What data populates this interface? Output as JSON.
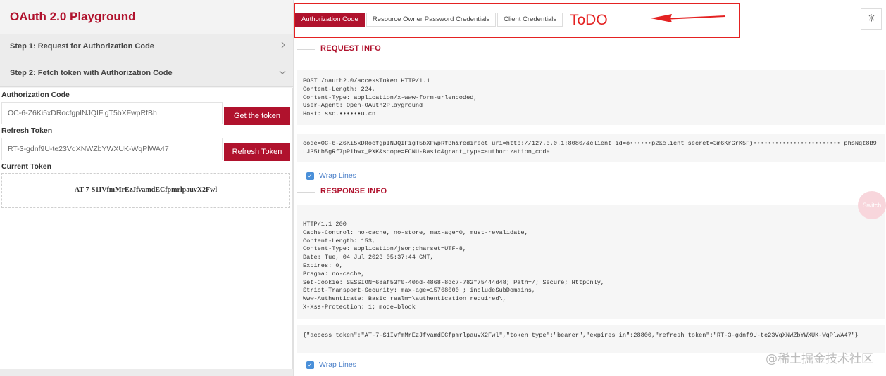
{
  "app": {
    "title": "OAuth 2.0 Playground"
  },
  "steps": [
    {
      "label": "Step 1: Request for Authorization Code",
      "chevron": "chevron-right-icon"
    },
    {
      "label": "Step 2: Fetch token with Authorization Code",
      "chevron": "chevron-down-icon"
    }
  ],
  "form": {
    "auth_code_label": "Authorization Code",
    "auth_code_value": "OC-6-Z6Ki5xDRocfgpINJQIFigT5bXFwpRfBh",
    "get_token_label": "Get the token",
    "refresh_token_label": "Refresh Token",
    "refresh_token_value": "RT-3-gdnf9U-te23VqXNWZbYWXUK-WqPlWA47",
    "refresh_button_label": "Refresh Token",
    "current_token_label": "Current Token",
    "current_token_value": "AT-7-S1IVfmMrEzJfvamdECfpmrlpauvX2Fwl"
  },
  "tabs": [
    {
      "label": "Authorization Code",
      "active": true
    },
    {
      "label": "Resource Owner Password Credentials",
      "active": false
    },
    {
      "label": "Client Credentials",
      "active": false
    }
  ],
  "annotation": {
    "text": "ToDO",
    "color": "#e42222"
  },
  "settings_icon": "gear-icon",
  "request": {
    "heading": "REQUEST INFO",
    "headers": "POST /oauth2.0/accessToken HTTP/1.1\nContent-Length: 224,\nContent-Type: application/x-www-form-urlencoded,\nUser-Agent: Open-OAuth2Playground\nHost: sso.••••••u.cn",
    "body": "code=OC-6-Z6Ki5xDRocfgpINJQIFigT5bXFwpRfBh&redirect_uri=http://127.0.0.1:8080/&client_id=o••••••p2&client_secret=3m6KrGrK5Fj•••••••••••••••••••••••• phsNqt8B9LJ35tb5gRf7pPibwx_PXK&scope=ECNU-Basic&grant_type=authorization_code",
    "wrap_label": "Wrap Lines"
  },
  "response": {
    "heading": "RESPONSE INFO",
    "headers": "HTTP/1.1 200\nCache-Control: no-cache, no-store, max-age=0, must-revalidate,\nContent-Length: 153,\nContent-Type: application/json;charset=UTF-8,\nDate: Tue, 04 Jul 2023 05:37:44 GMT,\nExpires: 0,\nPragma: no-cache,\nSet-Cookie: SESSION=68af53f0-40bd-4868-8dc7-782f75444d48; Path=/; Secure; HttpOnly,\nStrict-Transport-Security: max-age=15768000 ; includeSubDomains,\nWww-Authenticate: Basic realm=\\authentication required\\,\nX-Xss-Protection: 1; mode=block",
    "body": "{\"access_token\":\"AT-7-S1IVfmMrEzJfvamdECfpmrlpauvX2Fwl\",\"token_type\":\"bearer\",\"expires_in\":28800,\"refresh_token\":\"RT-3-gdnf9U-te23VqXNWZbYWXUK-WqPlWA47\"}",
    "wrap_label": "Wrap Lines"
  },
  "switch_label": "Switch",
  "watermark": "@稀土掘金技术社区",
  "colors": {
    "brand": "#b0122d",
    "link": "#4a7fc8",
    "checkbox": "#4a90d9"
  }
}
